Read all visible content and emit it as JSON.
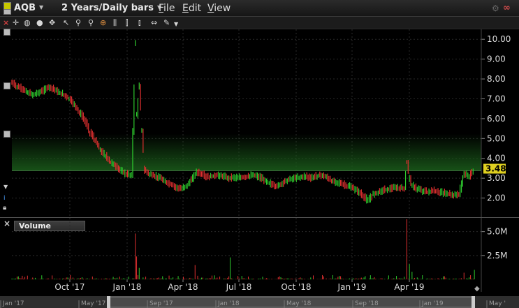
{
  "window": {
    "symbol": "AQB",
    "period": "2 Years/Daily bars",
    "menu": [
      "File",
      "Edit",
      "View"
    ]
  },
  "toolbar": {
    "icons": [
      "crosshair-icon",
      "eraser-icon",
      "circle-icon",
      "draw-line-icon",
      "zoom-in-icon",
      "zoom-out-icon",
      "target-icon",
      "bars-icon",
      "candles-icon",
      "ohlc-icon",
      "fit-icon",
      "tools-icon",
      "more-icon"
    ]
  },
  "colors": {
    "up": "#2ecc2e",
    "down": "#e03030",
    "last_price_bg": "#e0d020",
    "fill": "#1a5a1a"
  },
  "last_price": "3.48",
  "volume_label": "Volume",
  "chart_data": [
    {
      "type": "line",
      "title": "",
      "ylim": [
        1.0,
        10.5
      ],
      "y_ticks": [
        "2.00",
        "3.00",
        "4.00",
        "5.00",
        "6.00",
        "7.00",
        "8.00",
        "9.00",
        "10.00"
      ],
      "x_ticks": [
        "Oct '17",
        "Jan '18",
        "Apr '18",
        "Jul '18",
        "Oct '18",
        "Jan '19",
        "Apr '19"
      ],
      "series": [
        {
          "values": [
            [
              0,
              7.8
            ],
            [
              4,
              7.6
            ],
            [
              8,
              7.5
            ],
            [
              12,
              7.3
            ],
            [
              16,
              7.2
            ],
            [
              20,
              7.3
            ],
            [
              24,
              7.4
            ],
            [
              28,
              7.6
            ],
            [
              32,
              7.5
            ],
            [
              36,
              7.3
            ],
            [
              40,
              7.2
            ],
            [
              44,
              7.0
            ],
            [
              48,
              6.7
            ],
            [
              52,
              6.3
            ],
            [
              56,
              5.9
            ],
            [
              60,
              5.3
            ],
            [
              64,
              4.9
            ],
            [
              68,
              4.4
            ],
            [
              72,
              4.1
            ],
            [
              76,
              3.8
            ],
            [
              80,
              3.6
            ],
            [
              84,
              3.35
            ],
            [
              88,
              3.2
            ],
            [
              92,
              3.15
            ],
            [
              95,
              9.8
            ],
            [
              96,
              6.2
            ],
            [
              98,
              7.6
            ],
            [
              100,
              5.4
            ],
            [
              102,
              3.4
            ],
            [
              106,
              3.2
            ],
            [
              110,
              3.1
            ],
            [
              114,
              3.0
            ],
            [
              118,
              2.8
            ],
            [
              122,
              2.7
            ],
            [
              126,
              2.55
            ],
            [
              130,
              2.45
            ],
            [
              134,
              2.6
            ],
            [
              138,
              2.9
            ],
            [
              142,
              3.3
            ],
            [
              146,
              3.2
            ],
            [
              150,
              3.05
            ],
            [
              154,
              3.1
            ],
            [
              158,
              3.15
            ],
            [
              162,
              3.1
            ],
            [
              166,
              3.0
            ],
            [
              170,
              3.05
            ],
            [
              174,
              3.0
            ],
            [
              178,
              3.05
            ],
            [
              182,
              3.1
            ],
            [
              186,
              3.15
            ],
            [
              190,
              3.05
            ],
            [
              194,
              2.9
            ],
            [
              198,
              2.75
            ],
            [
              202,
              2.6
            ],
            [
              206,
              2.65
            ],
            [
              210,
              2.85
            ],
            [
              214,
              2.95
            ],
            [
              218,
              3.0
            ],
            [
              222,
              3.05
            ],
            [
              226,
              3.1
            ],
            [
              230,
              3.0
            ],
            [
              234,
              3.1
            ],
            [
              238,
              3.15
            ],
            [
              242,
              3.05
            ],
            [
              246,
              2.85
            ],
            [
              250,
              2.8
            ],
            [
              254,
              2.7
            ],
            [
              258,
              2.6
            ],
            [
              262,
              2.5
            ],
            [
              266,
              2.35
            ],
            [
              270,
              2.1
            ],
            [
              274,
              1.85
            ],
            [
              278,
              2.2
            ],
            [
              282,
              2.3
            ],
            [
              286,
              2.4
            ],
            [
              290,
              2.45
            ],
            [
              294,
              2.5
            ],
            [
              298,
              2.5
            ],
            [
              302,
              2.5
            ],
            [
              304,
              3.8
            ],
            [
              306,
              3.0
            ],
            [
              308,
              2.6
            ],
            [
              312,
              2.45
            ],
            [
              316,
              2.35
            ],
            [
              320,
              2.3
            ],
            [
              324,
              2.35
            ],
            [
              328,
              2.3
            ],
            [
              332,
              2.25
            ],
            [
              336,
              2.2
            ],
            [
              340,
              2.15
            ],
            [
              344,
              2.2
            ],
            [
              348,
              3.2
            ],
            [
              352,
              3.1
            ],
            [
              356,
              3.48
            ]
          ]
        }
      ]
    },
    {
      "type": "bar",
      "title": "Volume",
      "y_ticks": [
        "2.5M",
        "5.0M"
      ],
      "ylim": [
        0,
        6000000
      ]
    }
  ],
  "navigator": {
    "labels": [
      "Jan '17",
      "May '17",
      "Sep '17",
      "Jan '18",
      "May '18",
      "Sep '18",
      "Jan '19",
      "May '"
    ]
  }
}
